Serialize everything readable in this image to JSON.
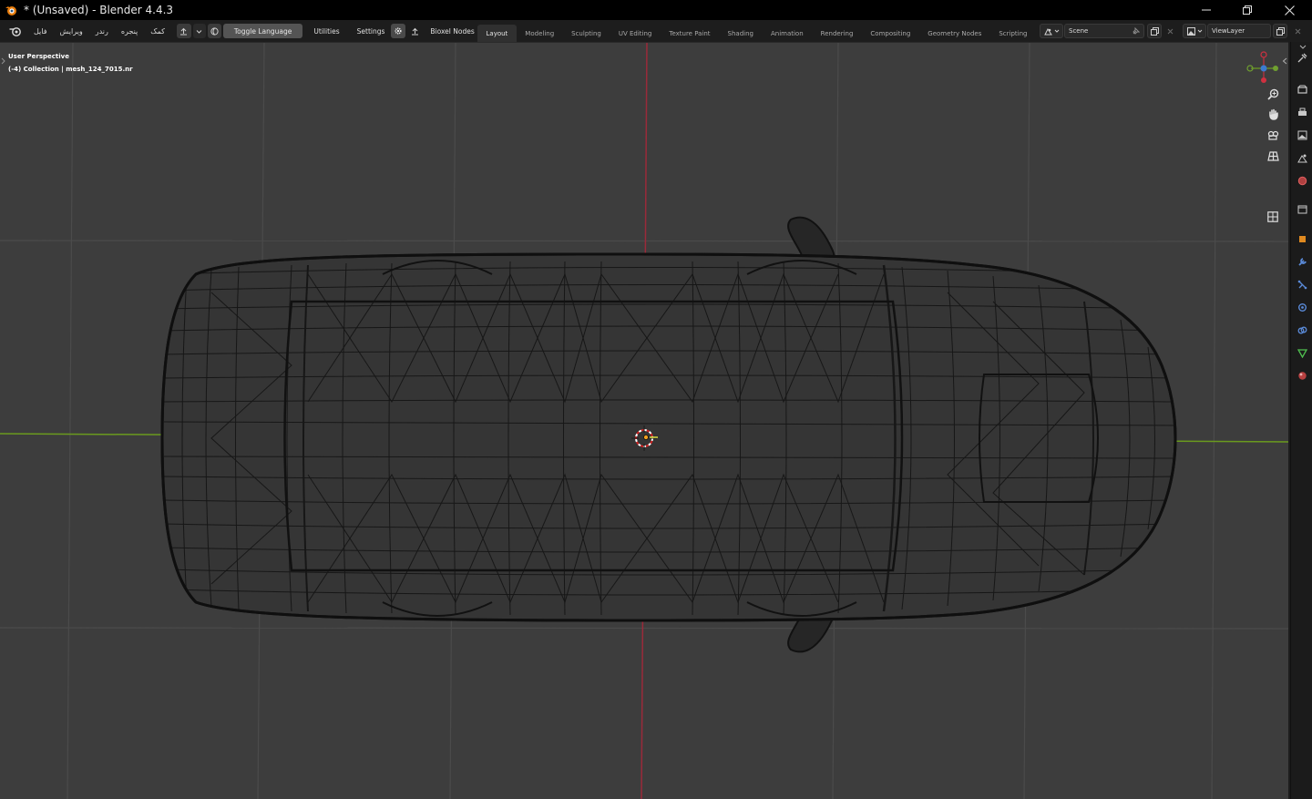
{
  "window": {
    "title": "* (Unsaved) - Blender 4.4.3",
    "minimize_icon": "minimize-icon",
    "maximize_icon": "restore-icon",
    "close_icon": "close-icon"
  },
  "menu": {
    "items": [
      "فایل",
      "ویرایش",
      "رندر",
      "پنجره",
      "کمک"
    ]
  },
  "header": {
    "toggle_language": "Toggle Language",
    "utilities": "Utilities",
    "settings": "Settings",
    "bioxel_nodes": "Bioxel Nodes"
  },
  "workspaces": {
    "tabs": [
      "Layout",
      "Modeling",
      "Sculpting",
      "UV Editing",
      "Texture Paint",
      "Shading",
      "Animation",
      "Rendering",
      "Compositing",
      "Geometry Nodes",
      "Scripting"
    ],
    "active": "Layout",
    "add_label": "+"
  },
  "scene": {
    "value": "Scene"
  },
  "view_layer": {
    "value": "ViewLayer"
  },
  "viewport": {
    "view_name": "User Perspective",
    "collection_info": "(-4) Collection | mesh_124_7015.nr"
  },
  "colors": {
    "viewport_bg": "#3d3d3d",
    "grid": "#4a4a4a",
    "x_axis": "#9a2a3a",
    "y_axis": "#6a9a1e",
    "wire": "#141414",
    "active_tab": "#303030"
  }
}
